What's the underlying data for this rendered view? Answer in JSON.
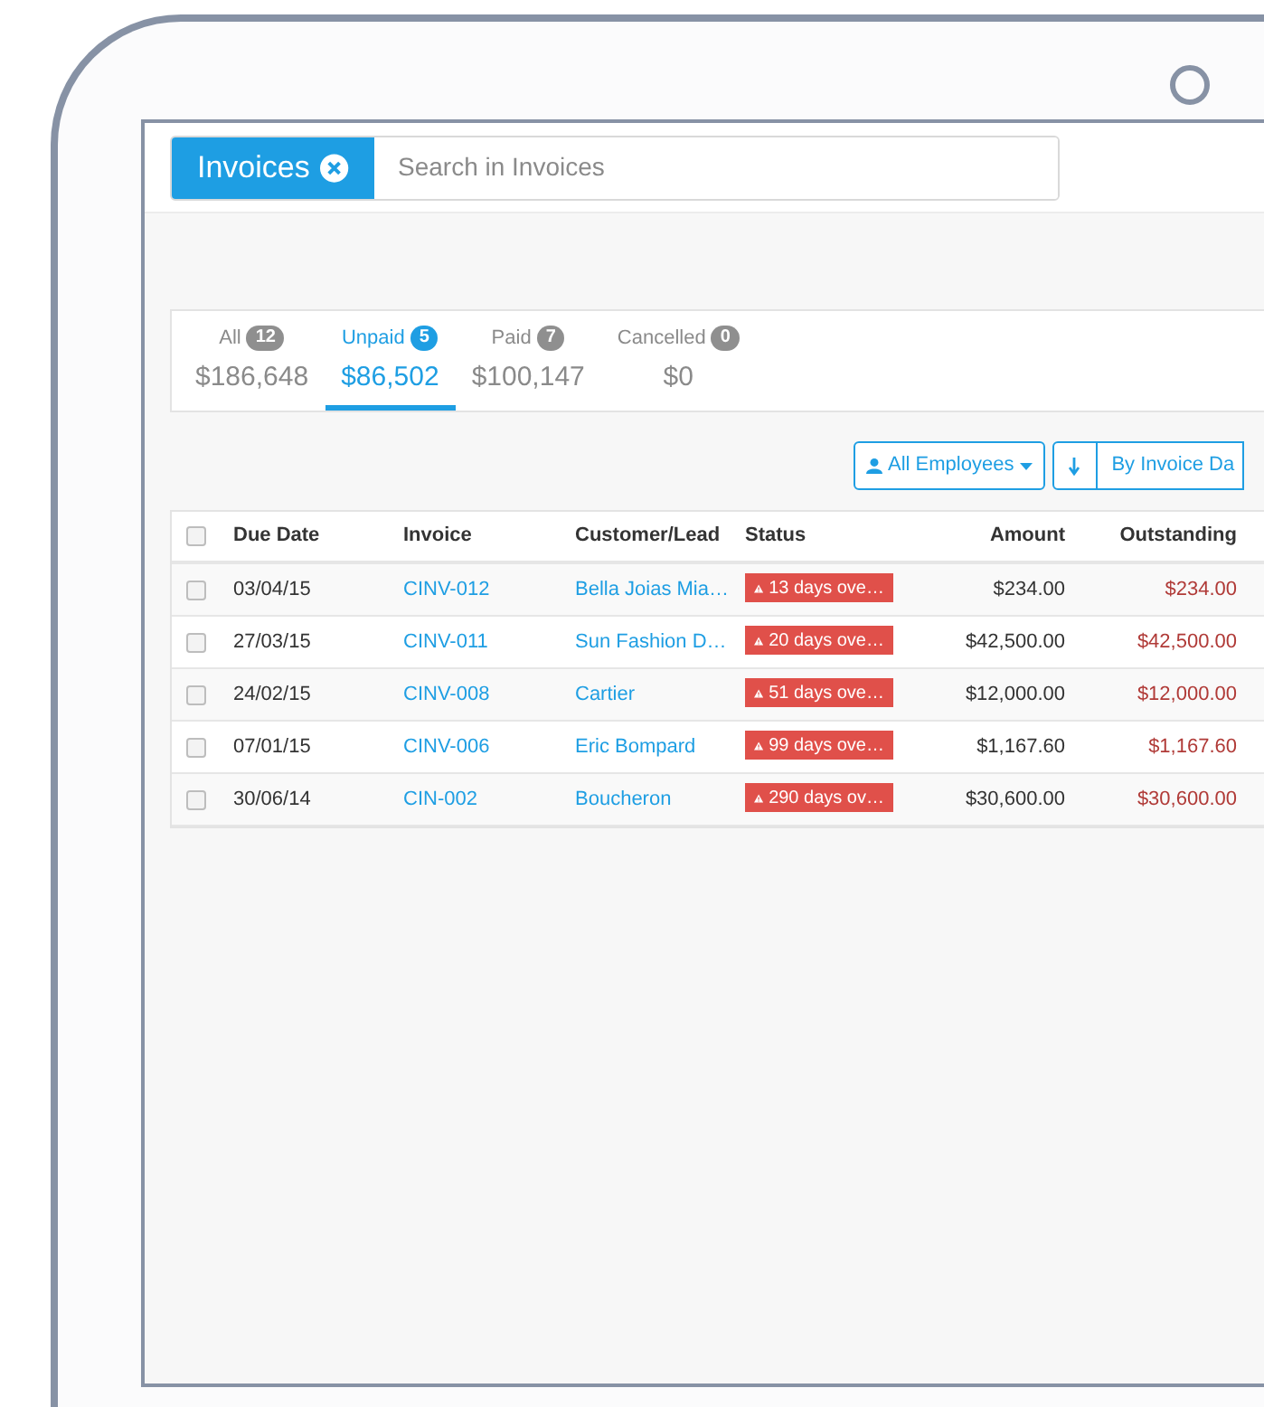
{
  "search": {
    "scope": "Invoices",
    "placeholder": "Search in Invoices"
  },
  "tabs": [
    {
      "label": "All",
      "count": "12",
      "amount": "$186,648",
      "selected": false
    },
    {
      "label": "Unpaid",
      "count": "5",
      "amount": "$86,502",
      "selected": true
    },
    {
      "label": "Paid",
      "count": "7",
      "amount": "$100,147",
      "selected": false
    },
    {
      "label": "Cancelled",
      "count": "0",
      "amount": "$0",
      "selected": false
    }
  ],
  "filters": {
    "employees": "All Employees",
    "sort": "By Invoice Da"
  },
  "table": {
    "all_checked": false,
    "columns": [
      "Due Date",
      "Invoice",
      "Customer/Lead",
      "Status",
      "Amount",
      "Outstanding"
    ],
    "rows": [
      {
        "checked": false,
        "due_date": "03/04/15",
        "invoice": "CINV-012",
        "customer": "Bella Joias Mia…",
        "status": "13 days ove…",
        "amount": "$234.00",
        "outstanding": "$234.00"
      },
      {
        "checked": false,
        "due_date": "27/03/15",
        "invoice": "CINV-011",
        "customer": "Sun Fashion D…",
        "status": "20 days ove…",
        "amount": "$42,500.00",
        "outstanding": "$42,500.00"
      },
      {
        "checked": false,
        "due_date": "24/02/15",
        "invoice": "CINV-008",
        "customer": "Cartier",
        "status": "51 days ove…",
        "amount": "$12,000.00",
        "outstanding": "$12,000.00"
      },
      {
        "checked": false,
        "due_date": "07/01/15",
        "invoice": "CINV-006",
        "customer": "Eric Bompard",
        "status": "99 days ove…",
        "amount": "$1,167.60",
        "outstanding": "$1,167.60"
      },
      {
        "checked": false,
        "due_date": "30/06/14",
        "invoice": "CIN-002",
        "customer": "Boucheron",
        "status": "290 days ov…",
        "amount": "$30,600.00",
        "outstanding": "$30,600.00"
      }
    ]
  }
}
